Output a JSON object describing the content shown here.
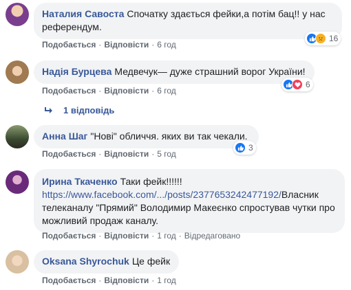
{
  "comments": [
    {
      "author": "Наталия Савоста",
      "text": "Спочатку здається фейки,а потім бац!! у нас референдум.",
      "like_label": "Подобається",
      "reply_label": "Відповісти",
      "time": "6 год",
      "reactions": [
        "like",
        "sad"
      ],
      "reaction_count": "16",
      "avatar_color": "#7a3e8e"
    },
    {
      "author": "Надія Бурцева",
      "text": "Медвечук— дуже страшний ворог України!",
      "like_label": "Подобається",
      "reply_label": "Відповісти",
      "time": "6 год",
      "reactions": [
        "like",
        "love"
      ],
      "reaction_count": "6",
      "avatar_color": "#b08a5c"
    },
    {
      "author": "Анна Шаг",
      "text": "\"Нові\" обличчя. яких ви так чекали.",
      "like_label": "Подобається",
      "reply_label": "Відповісти",
      "time": "5 год",
      "reactions": [
        "like"
      ],
      "reaction_count": "3",
      "avatar_color": "#4a5a3a"
    },
    {
      "author": "Ирина Ткаченко",
      "text": "Таки фейк!!!!!!",
      "link": "https://www.facebook.com/.../posts/2377653242477192/",
      "text2": "Власник телеканалу \"Прямий\" Володимир Макеєнко спростував чутки про можливий продаж каналу.",
      "like_label": "Подобається",
      "reply_label": "Відповісти",
      "time": "1 год",
      "edited": "Відредаговано",
      "avatar_color": "#6a2a7a"
    },
    {
      "author": "Oksana Shyrochuk",
      "text": "Це фейк",
      "like_label": "Подобається",
      "reply_label": "Відповісти",
      "time": "1 год",
      "avatar_color": "#d8c0a0"
    }
  ],
  "replies": {
    "label": "1 відповідь"
  },
  "dot": "·"
}
